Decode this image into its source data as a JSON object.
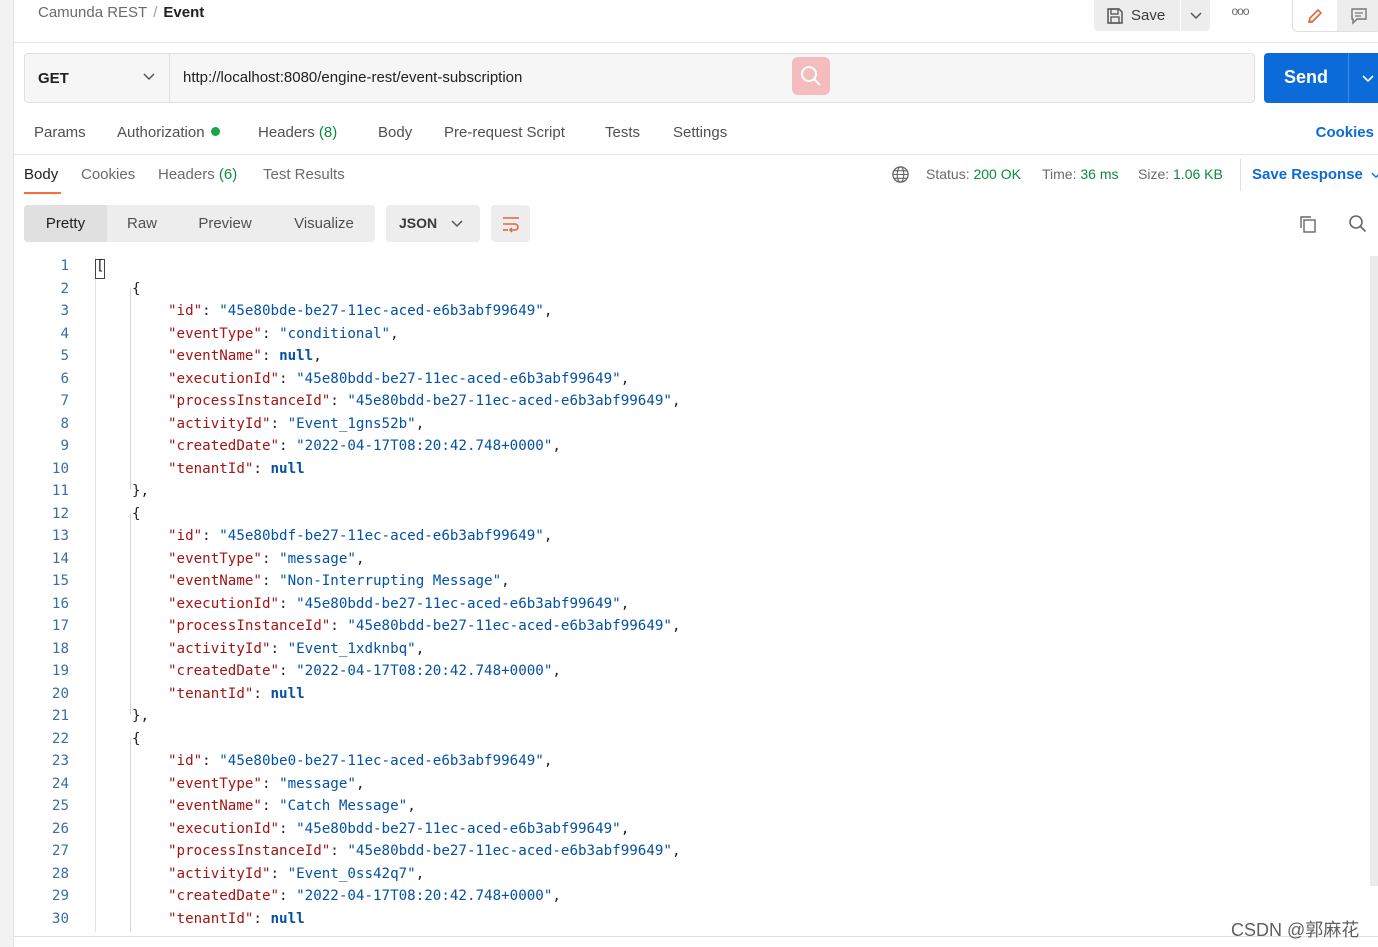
{
  "breadcrumb": {
    "collection": "Camunda REST",
    "separator": "/",
    "request": "Event"
  },
  "header": {
    "save_label": "Save",
    "more_label": "ooo"
  },
  "request": {
    "method": "GET",
    "url": "http://localhost:8080/engine-rest/event-subscription",
    "send_label": "Send"
  },
  "request_tabs": {
    "params": "Params",
    "authorization": "Authorization",
    "headers": "Headers",
    "headers_count": "(8)",
    "body": "Body",
    "pre_request": "Pre-request Script",
    "tests": "Tests",
    "settings": "Settings",
    "cookies": "Cookies"
  },
  "response_tabs": {
    "body": "Body",
    "cookies": "Cookies",
    "headers": "Headers",
    "headers_count": "(6)",
    "test_results": "Test Results"
  },
  "response_meta": {
    "status_label": "Status:",
    "status_value": "200 OK",
    "time_label": "Time:",
    "time_value": "36 ms",
    "size_label": "Size:",
    "size_value": "1.06 KB",
    "save_response": "Save Response"
  },
  "view_modes": {
    "pretty": "Pretty",
    "raw": "Raw",
    "preview": "Preview",
    "visualize": "Visualize",
    "format": "JSON"
  },
  "code_lines": [
    [
      [
        "p",
        "["
      ]
    ],
    [
      [
        "p",
        "{"
      ]
    ],
    [
      [
        "k",
        "\"id\""
      ],
      [
        "p",
        ": "
      ],
      [
        "s",
        "\"45e80bde-be27-11ec-aced-e6b3abf99649\""
      ],
      [
        "p",
        ","
      ]
    ],
    [
      [
        "k",
        "\"eventType\""
      ],
      [
        "p",
        ": "
      ],
      [
        "s",
        "\"conditional\""
      ],
      [
        "p",
        ","
      ]
    ],
    [
      [
        "k",
        "\"eventName\""
      ],
      [
        "p",
        ": "
      ],
      [
        "n",
        "null"
      ],
      [
        "p",
        ","
      ]
    ],
    [
      [
        "k",
        "\"executionId\""
      ],
      [
        "p",
        ": "
      ],
      [
        "s",
        "\"45e80bdd-be27-11ec-aced-e6b3abf99649\""
      ],
      [
        "p",
        ","
      ]
    ],
    [
      [
        "k",
        "\"processInstanceId\""
      ],
      [
        "p",
        ": "
      ],
      [
        "s",
        "\"45e80bdd-be27-11ec-aced-e6b3abf99649\""
      ],
      [
        "p",
        ","
      ]
    ],
    [
      [
        "k",
        "\"activityId\""
      ],
      [
        "p",
        ": "
      ],
      [
        "s",
        "\"Event_1gns52b\""
      ],
      [
        "p",
        ","
      ]
    ],
    [
      [
        "k",
        "\"createdDate\""
      ],
      [
        "p",
        ": "
      ],
      [
        "s",
        "\"2022-04-17T08:20:42.748+0000\""
      ],
      [
        "p",
        ","
      ]
    ],
    [
      [
        "k",
        "\"tenantId\""
      ],
      [
        "p",
        ": "
      ],
      [
        "n",
        "null"
      ]
    ],
    [
      [
        "p",
        "},"
      ]
    ],
    [
      [
        "p",
        "{"
      ]
    ],
    [
      [
        "k",
        "\"id\""
      ],
      [
        "p",
        ": "
      ],
      [
        "s",
        "\"45e80bdf-be27-11ec-aced-e6b3abf99649\""
      ],
      [
        "p",
        ","
      ]
    ],
    [
      [
        "k",
        "\"eventType\""
      ],
      [
        "p",
        ": "
      ],
      [
        "s",
        "\"message\""
      ],
      [
        "p",
        ","
      ]
    ],
    [
      [
        "k",
        "\"eventName\""
      ],
      [
        "p",
        ": "
      ],
      [
        "s",
        "\"Non-Interrupting Message\""
      ],
      [
        "p",
        ","
      ]
    ],
    [
      [
        "k",
        "\"executionId\""
      ],
      [
        "p",
        ": "
      ],
      [
        "s",
        "\"45e80bdd-be27-11ec-aced-e6b3abf99649\""
      ],
      [
        "p",
        ","
      ]
    ],
    [
      [
        "k",
        "\"processInstanceId\""
      ],
      [
        "p",
        ": "
      ],
      [
        "s",
        "\"45e80bdd-be27-11ec-aced-e6b3abf99649\""
      ],
      [
        "p",
        ","
      ]
    ],
    [
      [
        "k",
        "\"activityId\""
      ],
      [
        "p",
        ": "
      ],
      [
        "s",
        "\"Event_1xdknbq\""
      ],
      [
        "p",
        ","
      ]
    ],
    [
      [
        "k",
        "\"createdDate\""
      ],
      [
        "p",
        ": "
      ],
      [
        "s",
        "\"2022-04-17T08:20:42.748+0000\""
      ],
      [
        "p",
        ","
      ]
    ],
    [
      [
        "k",
        "\"tenantId\""
      ],
      [
        "p",
        ": "
      ],
      [
        "n",
        "null"
      ]
    ],
    [
      [
        "p",
        "},"
      ]
    ],
    [
      [
        "p",
        "{"
      ]
    ],
    [
      [
        "k",
        "\"id\""
      ],
      [
        "p",
        ": "
      ],
      [
        "s",
        "\"45e80be0-be27-11ec-aced-e6b3abf99649\""
      ],
      [
        "p",
        ","
      ]
    ],
    [
      [
        "k",
        "\"eventType\""
      ],
      [
        "p",
        ": "
      ],
      [
        "s",
        "\"message\""
      ],
      [
        "p",
        ","
      ]
    ],
    [
      [
        "k",
        "\"eventName\""
      ],
      [
        "p",
        ": "
      ],
      [
        "s",
        "\"Catch Message\""
      ],
      [
        "p",
        ","
      ]
    ],
    [
      [
        "k",
        "\"executionId\""
      ],
      [
        "p",
        ": "
      ],
      [
        "s",
        "\"45e80bdd-be27-11ec-aced-e6b3abf99649\""
      ],
      [
        "p",
        ","
      ]
    ],
    [
      [
        "k",
        "\"processInstanceId\""
      ],
      [
        "p",
        ": "
      ],
      [
        "s",
        "\"45e80bdd-be27-11ec-aced-e6b3abf99649\""
      ],
      [
        "p",
        ","
      ]
    ],
    [
      [
        "k",
        "\"activityId\""
      ],
      [
        "p",
        ": "
      ],
      [
        "s",
        "\"Event_0ss42q7\""
      ],
      [
        "p",
        ","
      ]
    ],
    [
      [
        "k",
        "\"createdDate\""
      ],
      [
        "p",
        ": "
      ],
      [
        "s",
        "\"2022-04-17T08:20:42.748+0000\""
      ],
      [
        "p",
        ","
      ]
    ],
    [
      [
        "k",
        "\"tenantId\""
      ],
      [
        "p",
        ": "
      ],
      [
        "n",
        "null"
      ]
    ]
  ],
  "watermark": "CSDN @郭麻花",
  "icons": {
    "save": "save-icon",
    "caret": "chevron-down-icon",
    "more": "more-icon",
    "edit": "pencil-icon",
    "comments": "comment-icon",
    "url_search": "search-icon",
    "globe": "globe-icon",
    "wrap": "wrap-lines-icon",
    "copy": "copy-icon",
    "find": "search-icon"
  },
  "colors": {
    "accent": "#0b6bd9",
    "tab_underline": "#ff6c37",
    "success": "#0c8a3c",
    "json_key": "#a31515",
    "json_value": "#0451a5"
  }
}
